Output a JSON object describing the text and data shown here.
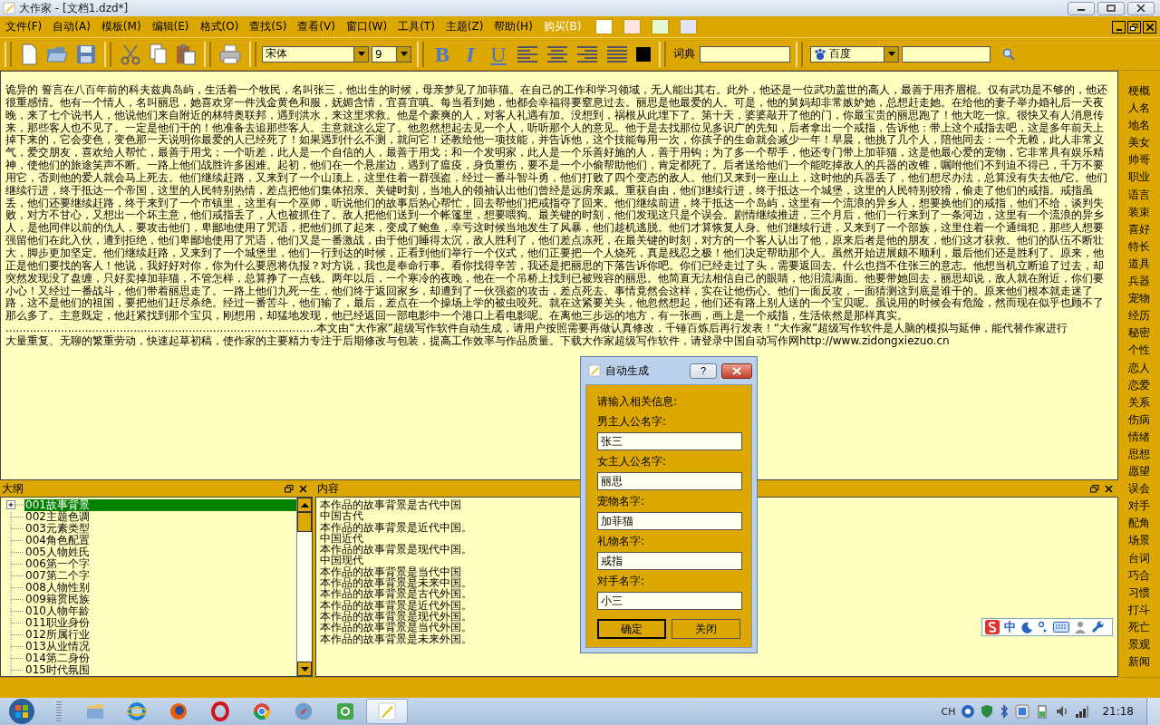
{
  "window": {
    "title": "大作家 - [文档1.dzd*]"
  },
  "menu": [
    {
      "label": "文件(F)",
      "kind": "normal"
    },
    {
      "label": "自动(A)",
      "kind": "normal"
    },
    {
      "label": "模板(M)",
      "kind": "normal"
    },
    {
      "label": "编辑(E)",
      "kind": "normal"
    },
    {
      "label": "格式(O)",
      "kind": "normal"
    },
    {
      "label": "查找(S)",
      "kind": "normal"
    },
    {
      "label": "查看(V)",
      "kind": "normal"
    },
    {
      "label": "窗口(W)",
      "kind": "normal"
    },
    {
      "label": "工具(T)",
      "kind": "normal"
    },
    {
      "label": "主题(Z)",
      "kind": "normal"
    },
    {
      "label": "帮助(H)",
      "kind": "normal"
    },
    {
      "label": "购买(B)",
      "kind": "highlight"
    }
  ],
  "color_swatches": [
    {
      "color": "#ffffff"
    },
    {
      "color": "#fde4e0"
    },
    {
      "color": "#e4f8d8"
    },
    {
      "color": "#e4e4f8"
    }
  ],
  "toolbar": {
    "font": "宋体",
    "size": "9",
    "format_buttons": [
      "B",
      "I",
      "U"
    ],
    "dictionary_label": "词典",
    "search_engine": "百度"
  },
  "document": {
    "lines": [
      "诡异的 誓言在八百年前的科夫兹典岛屿，生活着一个牧民，名叫张三，他出生的时候，母亲梦见了加菲猫。在自己的工作和学习领域，无人能出其右。此外，他还是一位武功盖世的高人，最善于用齐眉棍。仅有武功是不够的，他还",
      "很重感情。他有一个情人，名叫丽思，她喜欢穿一件浅金黄色和服，妩媚含情，宜喜宜嗔。每当看到她，他都会幸福得要窒息过去。丽思是他最爱的人。可是，他的舅妈却非常嫉妒她，总想赶走她。在给他的妻子举办婚礼后一天夜",
      "晚，来了七个说书人，他说他们来自附近的林特奥联邦，遇到洪水，来这里求救。他是个豪爽的人，对客人礼遇有加。没想到，祸根从此埋下了。第十天，婆婆敲开了他的门，你最宝贵的丽思跑了！他大吃一惊。很快又有人消息传",
      "来，那些客人也不见了。一定是他们干的！他准备去追那些客人。主意就这么定了。他忽然想起去见一个人，听听那个人的意见。他于是去找那位见多识广的先知，后者拿出一个戒指，告诉他：带上这个戒指去吧，这是多年前天上",
      "掉下来的，它会变色，变色那一天说明你最爱的人已经死了！如果遇到什么不测，就问它！还教给他一项技能，并告诉他，这个技能每用一次，你孩子的生命就会减少一年！早晨，他挑了几个人，陪他同去：一个无赖，此人非常义",
      "气，爱交朋友，喜欢给人帮忙，最善于用戈；一个听差，此人是一个自信的人，最善于用戈；和一个发明家，此人是一个乐善好施的人，善于用钩；为了多一个帮手，他还专门带上加菲猫，这是他最心爱的宠物，它非常具有娱乐精",
      "神，使他们的旅途笑声不断。一路上他们战胜许多困难。起初，他们在一个悬崖边，遇到了瘟疫，身负重伤，要不是一个小偷帮助他们，肯定都死了。后者送给他们一个能吃掉敌人的兵器的改锥，嘱咐他们不到迫不得已，千万不要",
      "用它，否则他的爱人就会马上死去。他们继续赶路，又来到了一个山顶上，这里住着一群强盗，经过一番斗智斗勇，他们打败了四个变态的敌人。他们又来到一座山上，这时他的兵器丢了，他们想尽办法，总算没有失去他/它。他们",
      "继续行进，终于抵达一个帝国，这里的人民特别热情，差点把他们集体招亲。关键时刻，当地人的领袖认出他们曾经是远房亲戚。重获自由，他们继续行进，终于抵达一个城堡，这里的人民特别狡猾，偷走了他们的戒指。戒指虽",
      "丢，他们还要继续赶路，终于来到了一个市镇里，这里有一个巫师，听说他们的故事后热心帮忙，回去帮他们把戒指夺了回来。他们继续前进，终于抵达一个岛屿，这里有一个流浪的异乡人，想要换他们的戒指，他们不给，谈判失",
      "败，对方不甘心，又想出一个坏主意，他们戒指丢了，人也被抓住了。敌人把他们送到一个帐篷里，想要喂狗。最关键的时刻，他们发现这只是个误会。剧情继续推进，三个月后，他们一行来到了一条河边，这里有一个流浪的异乡",
      "人，是他同伴以前的仇人，要攻击他们，卑鄙地使用了咒语，把他们抓了起来，变成了鲍鱼，幸亏这时候当地发生了风暴，他们趁机逃脱。他们才算恢复人身。他们继续行进，又来到了一个部族，这里住着一个通缉犯，那些人想要",
      "强留他们在此入伙，遭到拒绝，他们卑鄙地使用了咒语，他们又是一番激战，由于他们睡得太沉，敌人胜利了，他们差点冻死，在最关键的时刻，对方的一个客人认出了他，原来后者是他的朋友，他们这才获救。他们的队伍不断壮",
      "大，脚步更加坚定。他们继续赶路，又来到了一个城堡里，他们一行到达的时候，正看到他们举行一个仪式，他们正要把一个人烧死，真是残忍之极！他们决定帮助那个人。虽然开始进展颇不顺利，最后他们还是胜利了。原来，他",
      "正是他们要找的客人！他说，我好好对你，你为什么要恩将仇报？对方说，我也是奉命行事。看你找得辛苦，我还是把丽思的下落告诉你吧。你们已经走过了头，需要返回去。什么也挡不住张三的意志。他想当机立断追了过去，却",
      "突然发现没了盘缠，只好卖掉加菲猫，不管怎样，总算挣了一点钱。两年以后，一个寒冷的夜晚，他在一个吊桥上找到已被毁容的丽思。他简直无法相信自己的眼睛，他泪流满面。他要带她回去，丽思却说，敌人就在附近，你们要",
      "小心！又经过一番战斗，他们带着丽思走了。一路上他们九死一生，他们终于返回家乡，却遭到了一伙强盗的攻击，差点死去。事情竟然会这样，实在让他伤心。他们一面反攻，一面猜测这到底是谁干的。原来他们根本就走迷了",
      "路，这不是他们的祖国，要把他们赶尽杀绝。经过一番苦斗，他们输了，最后，差点在一个操场上学的被虫咬死。就在这紧要关头，他忽然想起，他们还有路上别人送的一个宝贝呢。虽说用的时候会有危险，然而现在似乎也顾不了",
      "那么多了。主意既定，他赶紧找到那个宝贝，刚想用，却猛地发现，他已经返回一部电影中一个港口上看电影呢。在离他三步远的地方，有一张画，画上是一个戒指，生活依然是那样真实。",
      "..........................................................................................本文由“大作家”超级写作软件自动生成，请用户按照需要再做认真修改，千锤百炼后再行发表！“大作家”超级写作软件是人脑的模拟与延伸，能代替作家进行",
      "大量重复、无聊的繁重劳动，快速起草初稿，使作家的主要精力专注于后期修改与包装，提高工作效率与作品质量。下载大作家超级写作软件，请登录中国自动写作网http://www.zidongxiezuo.cn"
    ]
  },
  "sidebar": {
    "items": [
      "梗概",
      "人名",
      "地名",
      "美女",
      "帅哥",
      "职业",
      "语言",
      "装束",
      "喜好",
      "特长",
      "道具",
      "兵器",
      "宠物",
      "经历",
      "秘密",
      "个性",
      "恋人",
      "恋爱",
      "关系",
      "伤病",
      "情绪",
      "思想",
      "愿望",
      "误会",
      "对手",
      "配角",
      "场景",
      "台词",
      "巧合",
      "习惯",
      "打斗",
      "死亡",
      "景观",
      "新闻"
    ]
  },
  "outline": {
    "title": "大纲",
    "items": [
      {
        "label": "001故事背景",
        "selected": true,
        "expandable": true
      },
      {
        "label": "002主题色调",
        "selected": false,
        "expandable": false
      },
      {
        "label": "003元素类型",
        "selected": false,
        "expandable": false
      },
      {
        "label": "004角色配置",
        "selected": false,
        "expandable": false
      },
      {
        "label": "005人物姓氏",
        "selected": false,
        "expandable": false
      },
      {
        "label": "006第一个字",
        "selected": false,
        "expandable": false
      },
      {
        "label": "007第二个字",
        "selected": false,
        "expandable": false
      },
      {
        "label": "008人物性别",
        "selected": false,
        "expandable": false
      },
      {
        "label": "009籍贯民族",
        "selected": false,
        "expandable": false
      },
      {
        "label": "010人物年龄",
        "selected": false,
        "expandable": false
      },
      {
        "label": "011职业身份",
        "selected": false,
        "expandable": false
      },
      {
        "label": "012所属行业",
        "selected": false,
        "expandable": false
      },
      {
        "label": "013从业情况",
        "selected": false,
        "expandable": false
      },
      {
        "label": "014第二身份",
        "selected": false,
        "expandable": false
      },
      {
        "label": "015时代氛围",
        "selected": false,
        "expandable": false
      }
    ]
  },
  "content": {
    "title": "内容",
    "lines": [
      "本作品的故事背景是古代中国",
      "中国古代",
      "本作品的故事背景是近代中国。",
      "中国近代",
      "本作品的故事背景是现代中国。",
      "中国现代",
      "本作品的故事背景是当代中国",
      "本作品的故事背景是未来中国。",
      "本作品的故事背景是古代外国。",
      "本作品的故事背景是近代外国。",
      "本作品的故事背景是现代外国。",
      "本作品的故事背景是当代外国。",
      "本作品的故事背景是未来外国。"
    ]
  },
  "dialog": {
    "title": "自动生成",
    "help": "?",
    "prompt": "请输入相关信息:",
    "fields": [
      {
        "label": "男主人公名字:",
        "value": "张三"
      },
      {
        "label": "女主人公名字:",
        "value": "丽思"
      },
      {
        "label": "宠物名字:",
        "value": "加菲猫"
      },
      {
        "label": "礼物名字:",
        "value": "戒指"
      },
      {
        "label": "对手名字:",
        "value": "小三"
      }
    ],
    "buttons": [
      "确定",
      "关闭"
    ]
  },
  "ime": {
    "mode": "中"
  },
  "taskbar": {
    "language": "CH",
    "clock": "21:18"
  }
}
